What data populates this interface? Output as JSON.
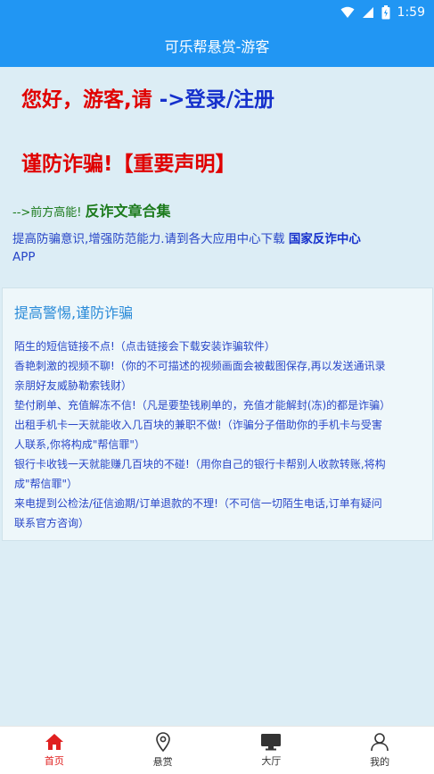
{
  "status": {
    "time": "1:59"
  },
  "header": {
    "title": "可乐帮悬赏-游客"
  },
  "greeting": {
    "prefix": "您好，游客,请 ",
    "login_label": "->登录/注册"
  },
  "warning": {
    "title": "谨防诈骗!【重要声明】"
  },
  "energy": {
    "prefix": "-->前方高能!",
    "link": "反诈文章合集"
  },
  "awareness": {
    "text": "提高防骗意识,增强防范能力.请到各大应用中心下载 ",
    "app_link": "国家反诈中心",
    "app_suffix": "APP"
  },
  "card": {
    "title": "提高警惕,谨防诈骗",
    "lines": [
      "陌生的短信链接不点!（点击链接会下载安装诈骗软件）",
      "香艳刺激的视频不聊!（你的不可描述的视频画面会被截图保存,再以发送通讯录",
      "亲朋好友威胁勒索钱财）",
      "垫付刷单、充值解冻不信!（凡是要垫钱刷单的，充值才能解封(冻)的都是诈骗）",
      "出租手机卡一天就能收入几百块的兼职不做!（诈骗分子借助你的手机卡与受害",
      "人联系,你将构成\"帮信罪\"）",
      "银行卡收钱一天就能赚几百块的不碰!（用你自己的银行卡帮别人收款转账,将构",
      "成\"帮信罪\"）",
      "来电提到公检法/征信逾期/订单退款的不理!（不可信一切陌生电话,订单有疑问",
      "联系官方咨询）"
    ]
  },
  "nav": {
    "items": [
      {
        "label": "首页",
        "icon": "home-icon",
        "active": true
      },
      {
        "label": "悬赏",
        "icon": "location-pin-icon",
        "active": false
      },
      {
        "label": "大厅",
        "icon": "monitor-icon",
        "active": false
      },
      {
        "label": "我的",
        "icon": "user-icon",
        "active": false
      }
    ],
    "active_color": "#e02020"
  },
  "colors": {
    "primary": "#2196f3",
    "alert_red": "#e00000",
    "link_blue": "#1530cc",
    "green": "#1b7a1b"
  }
}
